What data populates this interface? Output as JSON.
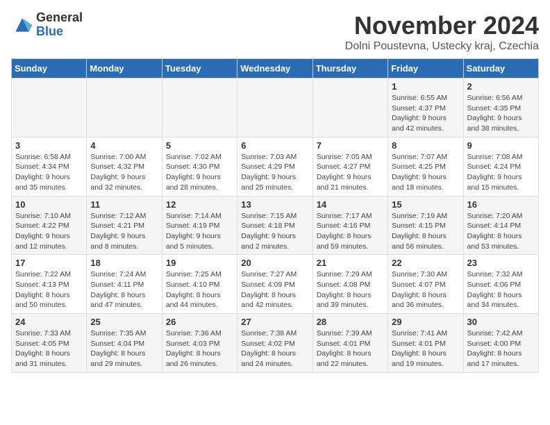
{
  "header": {
    "logo_general": "General",
    "logo_blue": "Blue",
    "month_title": "November 2024",
    "location": "Dolni Poustevna, Ustecky kraj, Czechia"
  },
  "days_of_week": [
    "Sunday",
    "Monday",
    "Tuesday",
    "Wednesday",
    "Thursday",
    "Friday",
    "Saturday"
  ],
  "weeks": [
    [
      {
        "day": "",
        "info": ""
      },
      {
        "day": "",
        "info": ""
      },
      {
        "day": "",
        "info": ""
      },
      {
        "day": "",
        "info": ""
      },
      {
        "day": "",
        "info": ""
      },
      {
        "day": "1",
        "info": "Sunrise: 6:55 AM\nSunset: 4:37 PM\nDaylight: 9 hours and 42 minutes."
      },
      {
        "day": "2",
        "info": "Sunrise: 6:56 AM\nSunset: 4:35 PM\nDaylight: 9 hours and 38 minutes."
      }
    ],
    [
      {
        "day": "3",
        "info": "Sunrise: 6:58 AM\nSunset: 4:34 PM\nDaylight: 9 hours and 35 minutes."
      },
      {
        "day": "4",
        "info": "Sunrise: 7:00 AM\nSunset: 4:32 PM\nDaylight: 9 hours and 32 minutes."
      },
      {
        "day": "5",
        "info": "Sunrise: 7:02 AM\nSunset: 4:30 PM\nDaylight: 9 hours and 28 minutes."
      },
      {
        "day": "6",
        "info": "Sunrise: 7:03 AM\nSunset: 4:29 PM\nDaylight: 9 hours and 25 minutes."
      },
      {
        "day": "7",
        "info": "Sunrise: 7:05 AM\nSunset: 4:27 PM\nDaylight: 9 hours and 21 minutes."
      },
      {
        "day": "8",
        "info": "Sunrise: 7:07 AM\nSunset: 4:25 PM\nDaylight: 9 hours and 18 minutes."
      },
      {
        "day": "9",
        "info": "Sunrise: 7:08 AM\nSunset: 4:24 PM\nDaylight: 9 hours and 15 minutes."
      }
    ],
    [
      {
        "day": "10",
        "info": "Sunrise: 7:10 AM\nSunset: 4:22 PM\nDaylight: 9 hours and 12 minutes."
      },
      {
        "day": "11",
        "info": "Sunrise: 7:12 AM\nSunset: 4:21 PM\nDaylight: 9 hours and 8 minutes."
      },
      {
        "day": "12",
        "info": "Sunrise: 7:14 AM\nSunset: 4:19 PM\nDaylight: 9 hours and 5 minutes."
      },
      {
        "day": "13",
        "info": "Sunrise: 7:15 AM\nSunset: 4:18 PM\nDaylight: 9 hours and 2 minutes."
      },
      {
        "day": "14",
        "info": "Sunrise: 7:17 AM\nSunset: 4:16 PM\nDaylight: 8 hours and 59 minutes."
      },
      {
        "day": "15",
        "info": "Sunrise: 7:19 AM\nSunset: 4:15 PM\nDaylight: 8 hours and 56 minutes."
      },
      {
        "day": "16",
        "info": "Sunrise: 7:20 AM\nSunset: 4:14 PM\nDaylight: 8 hours and 53 minutes."
      }
    ],
    [
      {
        "day": "17",
        "info": "Sunrise: 7:22 AM\nSunset: 4:13 PM\nDaylight: 8 hours and 50 minutes."
      },
      {
        "day": "18",
        "info": "Sunrise: 7:24 AM\nSunset: 4:11 PM\nDaylight: 8 hours and 47 minutes."
      },
      {
        "day": "19",
        "info": "Sunrise: 7:25 AM\nSunset: 4:10 PM\nDaylight: 8 hours and 44 minutes."
      },
      {
        "day": "20",
        "info": "Sunrise: 7:27 AM\nSunset: 4:09 PM\nDaylight: 8 hours and 42 minutes."
      },
      {
        "day": "21",
        "info": "Sunrise: 7:29 AM\nSunset: 4:08 PM\nDaylight: 8 hours and 39 minutes."
      },
      {
        "day": "22",
        "info": "Sunrise: 7:30 AM\nSunset: 4:07 PM\nDaylight: 8 hours and 36 minutes."
      },
      {
        "day": "23",
        "info": "Sunrise: 7:32 AM\nSunset: 4:06 PM\nDaylight: 8 hours and 34 minutes."
      }
    ],
    [
      {
        "day": "24",
        "info": "Sunrise: 7:33 AM\nSunset: 4:05 PM\nDaylight: 8 hours and 31 minutes."
      },
      {
        "day": "25",
        "info": "Sunrise: 7:35 AM\nSunset: 4:04 PM\nDaylight: 8 hours and 29 minutes."
      },
      {
        "day": "26",
        "info": "Sunrise: 7:36 AM\nSunset: 4:03 PM\nDaylight: 8 hours and 26 minutes."
      },
      {
        "day": "27",
        "info": "Sunrise: 7:38 AM\nSunset: 4:02 PM\nDaylight: 8 hours and 24 minutes."
      },
      {
        "day": "28",
        "info": "Sunrise: 7:39 AM\nSunset: 4:01 PM\nDaylight: 8 hours and 22 minutes."
      },
      {
        "day": "29",
        "info": "Sunrise: 7:41 AM\nSunset: 4:01 PM\nDaylight: 8 hours and 19 minutes."
      },
      {
        "day": "30",
        "info": "Sunrise: 7:42 AM\nSunset: 4:00 PM\nDaylight: 8 hours and 17 minutes."
      }
    ]
  ]
}
